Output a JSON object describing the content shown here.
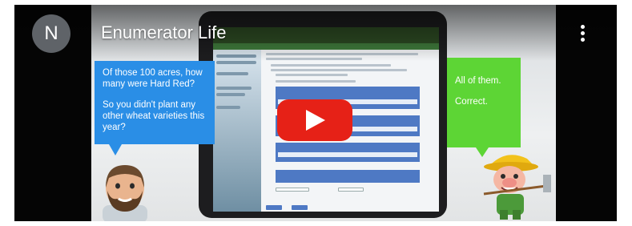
{
  "channel": {
    "avatar_letter": "N",
    "title": "Enumerator Life"
  },
  "player": {
    "menu_icon": "more-vert-icon",
    "play_icon": "play-icon",
    "play_color": "#e62117"
  },
  "dialog": {
    "question_lines": [
      "Of those 100 acres, how many were Hard Red?",
      "So you didn't plant any other wheat varieties this year?"
    ],
    "answer_lines": [
      "All of them.",
      "Correct."
    ],
    "question_color": "#2a8ee6",
    "answer_color": "#5dd535"
  },
  "characters": {
    "left": "bearded-man-avatar",
    "right": "farmer-cartoon"
  }
}
